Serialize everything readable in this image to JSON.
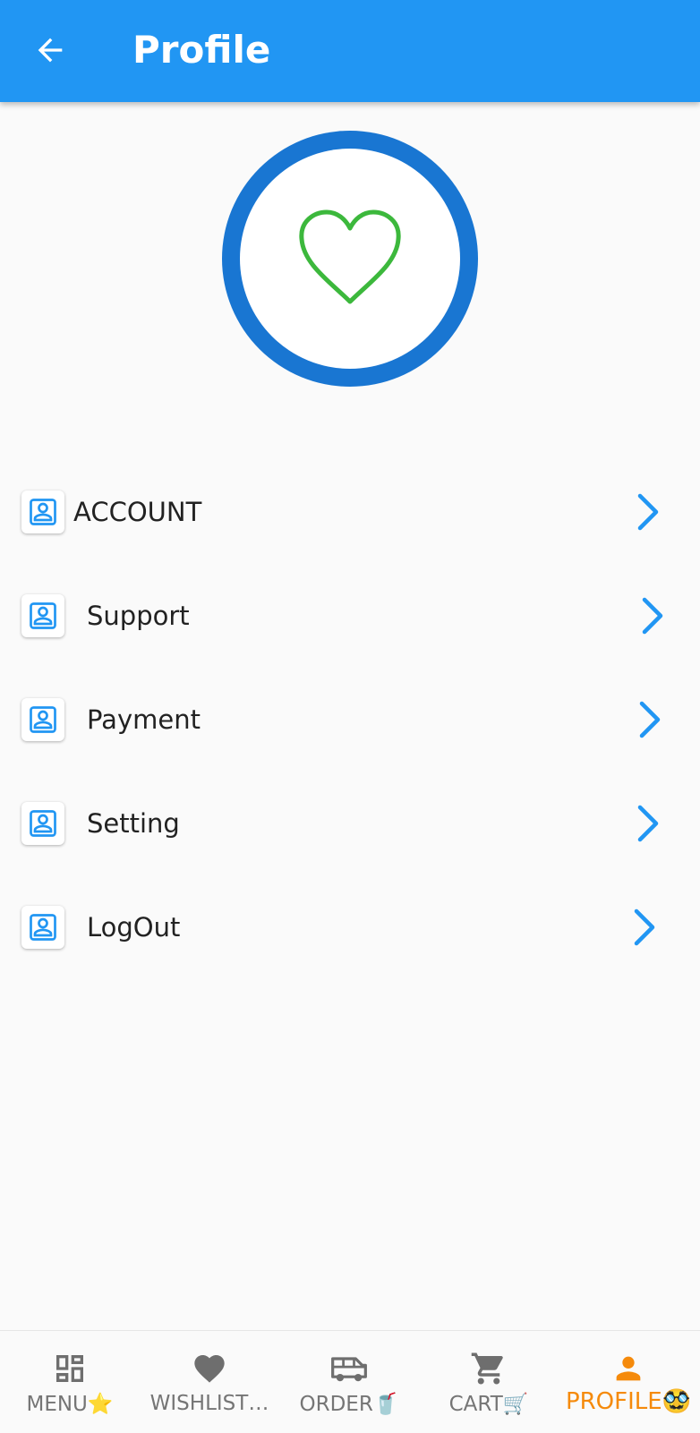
{
  "app_bar": {
    "title": "Profile",
    "back_icon": "arrow-back-icon",
    "background": "#2196f3"
  },
  "avatar": {
    "icon": "heart-outline-icon",
    "ring_color": "#1976d2",
    "icon_color": "#3cb83c"
  },
  "menu": {
    "items": [
      {
        "label": "ACCOUNT",
        "icon": "account-box-icon",
        "chevron": "chevron-right-icon"
      },
      {
        "label": "Support",
        "icon": "account-box-icon",
        "chevron": "chevron-right-icon"
      },
      {
        "label": "Payment",
        "icon": "account-box-icon",
        "chevron": "chevron-right-icon"
      },
      {
        "label": "Setting",
        "icon": "account-box-icon",
        "chevron": "chevron-right-icon"
      },
      {
        "label": "LogOut",
        "icon": "account-box-icon",
        "chevron": "chevron-right-icon"
      }
    ],
    "accent": "#2196f3"
  },
  "bottom_nav": {
    "items": [
      {
        "label": "MENU⭐",
        "icon": "dashboard-icon",
        "active": false
      },
      {
        "label": "WISHLIST…",
        "icon": "heart-icon",
        "active": false
      },
      {
        "label": "ORDER🥤",
        "icon": "delivery-van-icon",
        "active": false
      },
      {
        "label": "CART🛒",
        "icon": "shopping-cart-icon",
        "active": false
      },
      {
        "label": "PROFILE🥸",
        "icon": "person-icon",
        "active": true
      }
    ],
    "active_color": "#f58a0b",
    "inactive_color": "#757575"
  }
}
